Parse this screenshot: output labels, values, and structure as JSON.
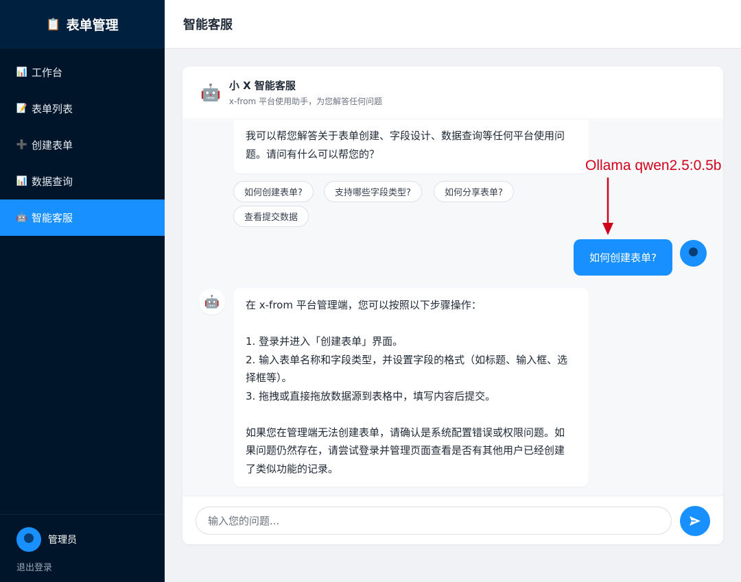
{
  "sidebar": {
    "brand_icon": "📋",
    "brand": "表单管理",
    "items": [
      {
        "icon": "📊",
        "label": "工作台",
        "active": false
      },
      {
        "icon": "📝",
        "label": "表单列表",
        "active": false
      },
      {
        "icon": "➕",
        "label": "创建表单",
        "active": false
      },
      {
        "icon": "📊",
        "label": "数据查询",
        "active": false
      },
      {
        "icon": "🤖",
        "label": "智能客服",
        "active": true
      }
    ],
    "user": {
      "name": "管理员",
      "logout": "退出登录"
    }
  },
  "header": {
    "title": "智能客服"
  },
  "chat": {
    "bot_icon": "🤖",
    "bot_name": "小 X 智能客服",
    "bot_subtitle": "x-from 平台使用助手，为您解答任何问题",
    "welcome_lines": [
      "我可以帮您解答关于表单创建、字段设计、数据查询等任何平台使用问",
      "题。请问有什么可以帮您的？"
    ],
    "quick_questions": [
      "如何创建表单?",
      "支持哪些字段类型?",
      "如何分享表单?",
      "查看提交数据"
    ],
    "user_message": "如何创建表单?",
    "bot_reply_lines": [
      "在 x-from 平台管理端，您可以按照以下步骤操作：",
      "",
      "1. 登录并进入「创建表单」界面。",
      "2. 输入表单名称和字段类型，并设置字段的格式（如标题、输入框、选",
      "择框等）。",
      "3. 拖拽或直接拖放数据源到表格中，填写内容后提交。",
      "",
      "如果您在管理端无法创建表单，请确认是系统配置错误或权限问题。如",
      "果问题仍然存在，请尝试登录并管理页面查看是否有其他用户已经创建",
      "了类似功能的记录。"
    ],
    "input_placeholder": "输入您的问题...",
    "send_icon": "send-icon"
  },
  "annotation": {
    "text": "Ollama qwen2.5:0.5b",
    "color": "#d0021b"
  },
  "colors": {
    "accent": "#1890ff",
    "sidebar_bg": "#001529",
    "brand_bg": "#00203f"
  }
}
